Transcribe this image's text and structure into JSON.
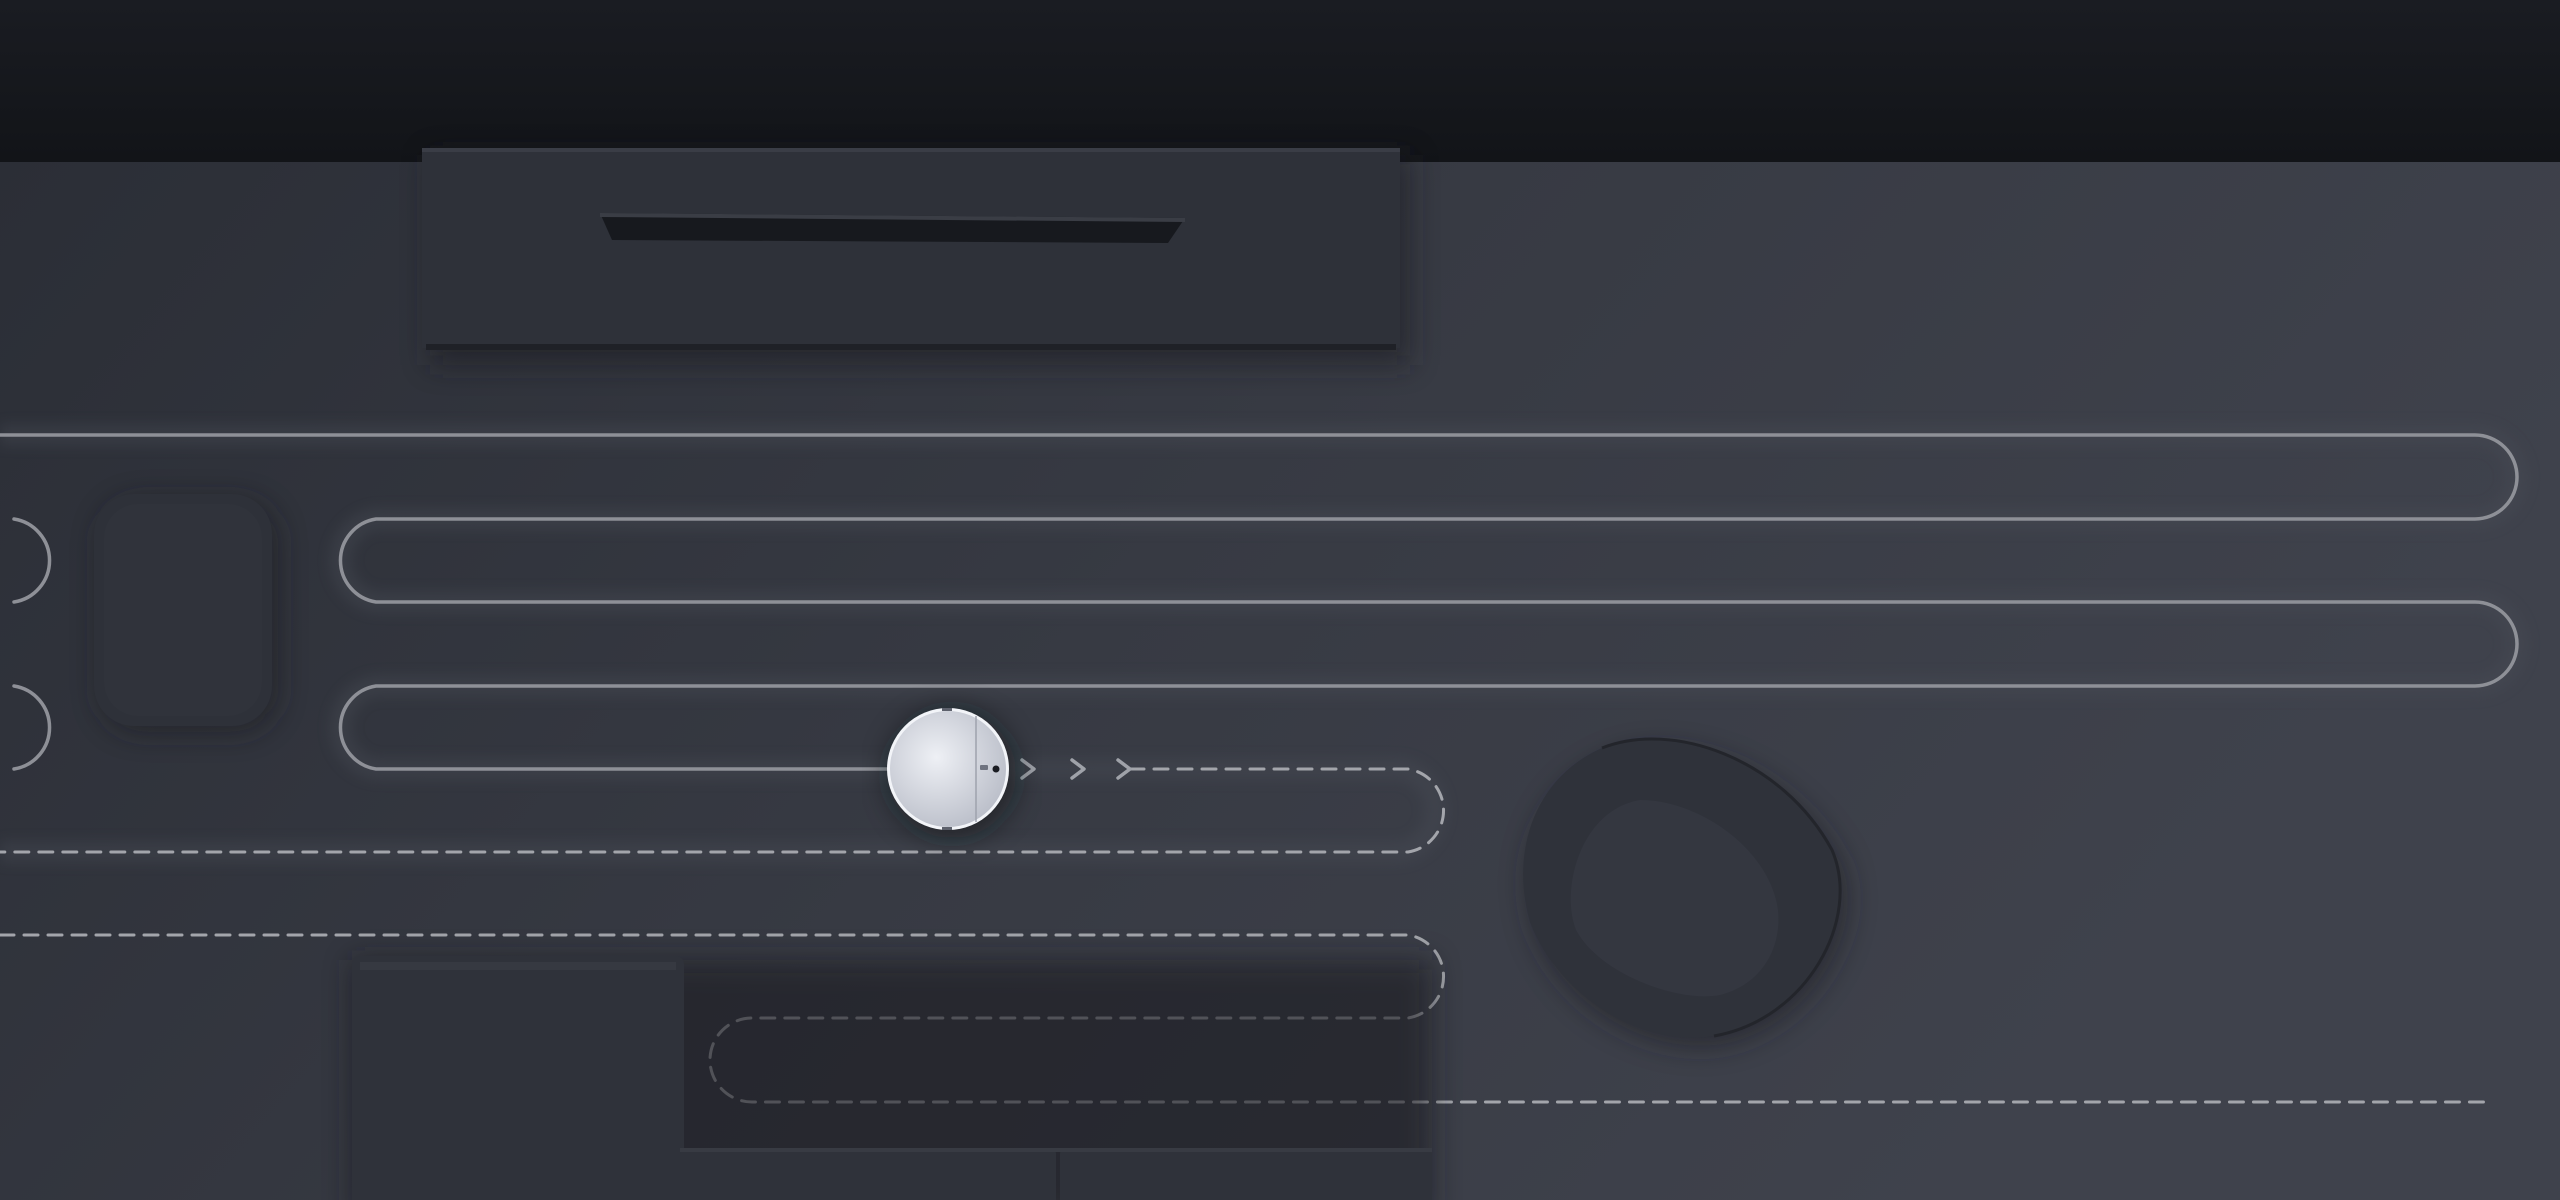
{
  "scene": {
    "subject": "robot-vacuum-cleaning-path",
    "path_styles": {
      "cleaned": "solid",
      "planned": "dashed"
    }
  },
  "colors": {
    "wall": "#15171c",
    "floor_light": "#3f424c",
    "floor_dark": "#2a2d35",
    "furniture": "#2f323a",
    "path_cleaned": "#8e9097",
    "path_planned": "#a3a5ab",
    "robot_body": "#d8dbe3"
  },
  "icons": {
    "robot": "robot-vacuum-icon",
    "direction": "chevron-right-icon"
  }
}
